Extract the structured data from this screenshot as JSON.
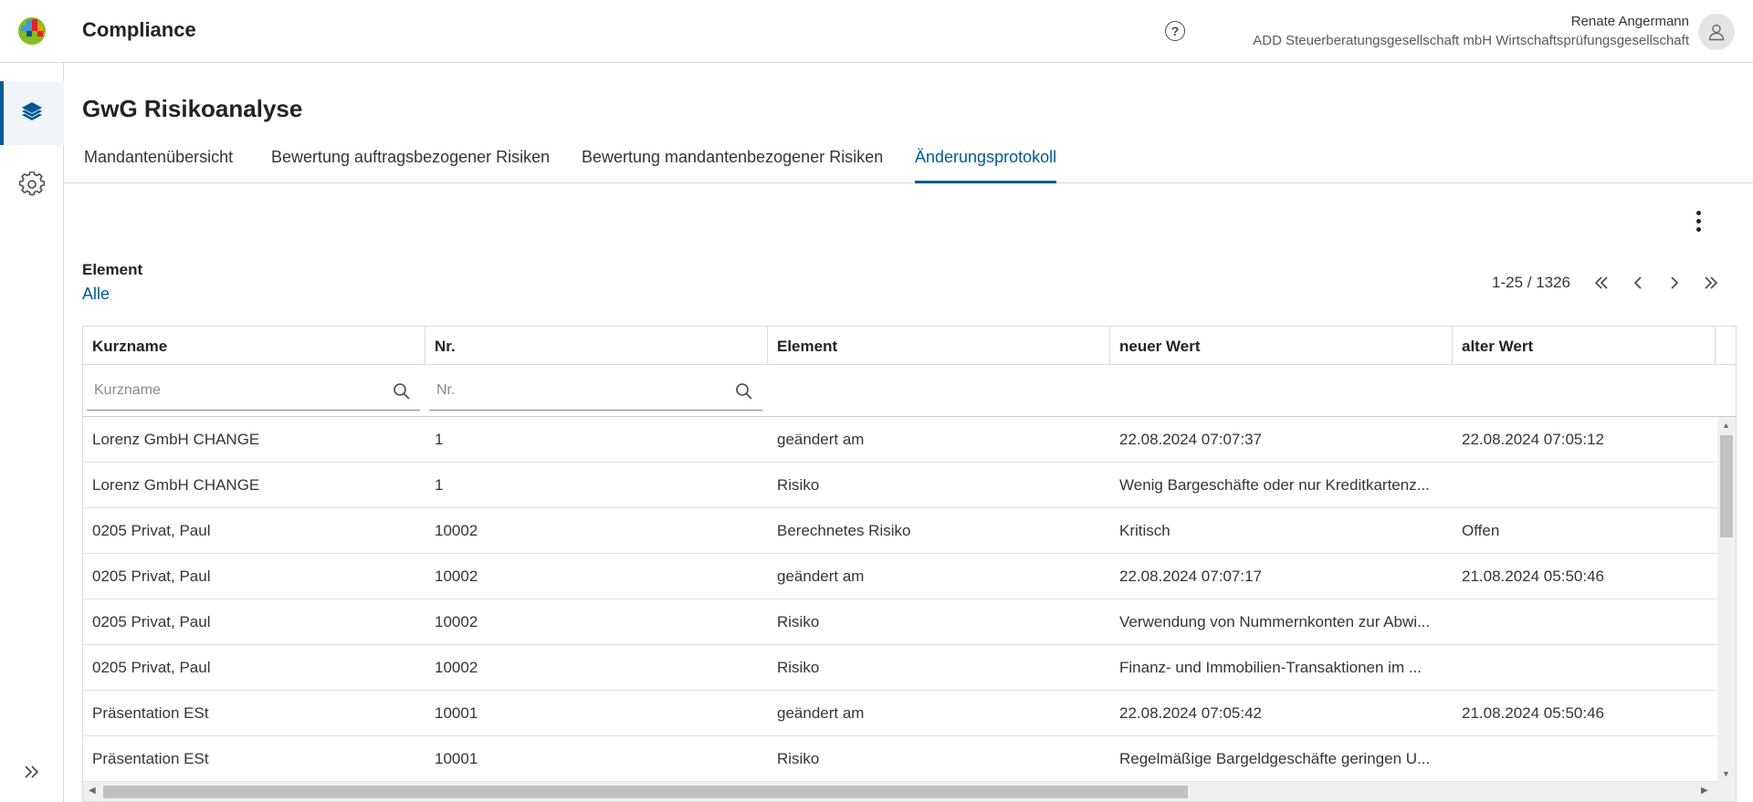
{
  "header": {
    "app_title": "Compliance",
    "user_name": "Renate Angermann",
    "user_company": "ADD Steuerberatungsgesellschaft mbH Wirtschaftsprüfungsgesellschaft"
  },
  "sidebar": {
    "items": [
      {
        "icon": "layers-icon",
        "active": true
      },
      {
        "icon": "gear-icon",
        "active": false
      }
    ],
    "expand_icon": "double-chevron-right-icon"
  },
  "page": {
    "title": "GwG Risikoanalyse",
    "tabs": [
      {
        "label": "Mandantenübersicht"
      },
      {
        "label": "Bewertung auftragsbezogener Risiken"
      },
      {
        "label": "Bewertung mandantenbezogener Risiken"
      },
      {
        "label": "Änderungsprotokoll",
        "active": true
      }
    ]
  },
  "filter": {
    "label": "Element",
    "value": "Alle"
  },
  "pager": {
    "range": "1-25 / 1326"
  },
  "table": {
    "columns": [
      "Kurzname",
      "Nr.",
      "Element",
      "neuer Wert",
      "alter Wert"
    ],
    "filters": {
      "kurzname_placeholder": "Kurzname",
      "nr_placeholder": "Nr."
    },
    "rows": [
      [
        "Lorenz GmbH CHANGE",
        "1",
        "geändert am",
        "22.08.2024 07:07:37",
        "22.08.2024 07:05:12"
      ],
      [
        "Lorenz GmbH CHANGE",
        "1",
        "Risiko",
        "Wenig Bargeschäfte oder nur Kreditkartenz...",
        ""
      ],
      [
        "0205 Privat, Paul",
        "10002",
        "Berechnetes Risiko",
        "Kritisch",
        "Offen"
      ],
      [
        "0205 Privat, Paul",
        "10002",
        "geändert am",
        "22.08.2024 07:07:17",
        "21.08.2024 05:50:46"
      ],
      [
        "0205 Privat, Paul",
        "10002",
        "Risiko",
        "Verwendung von Nummernkonten zur Abwi...",
        ""
      ],
      [
        "0205 Privat, Paul",
        "10002",
        "Risiko",
        "Finanz- und Immobilien-Transaktionen im ...",
        ""
      ],
      [
        "Präsentation ESt",
        "10001",
        "geändert am",
        "22.08.2024 07:05:42",
        "21.08.2024 05:50:46"
      ],
      [
        "Präsentation ESt",
        "10001",
        "Risiko",
        "Regelmäßige Bargeldgeschäfte geringen U...",
        ""
      ]
    ]
  }
}
